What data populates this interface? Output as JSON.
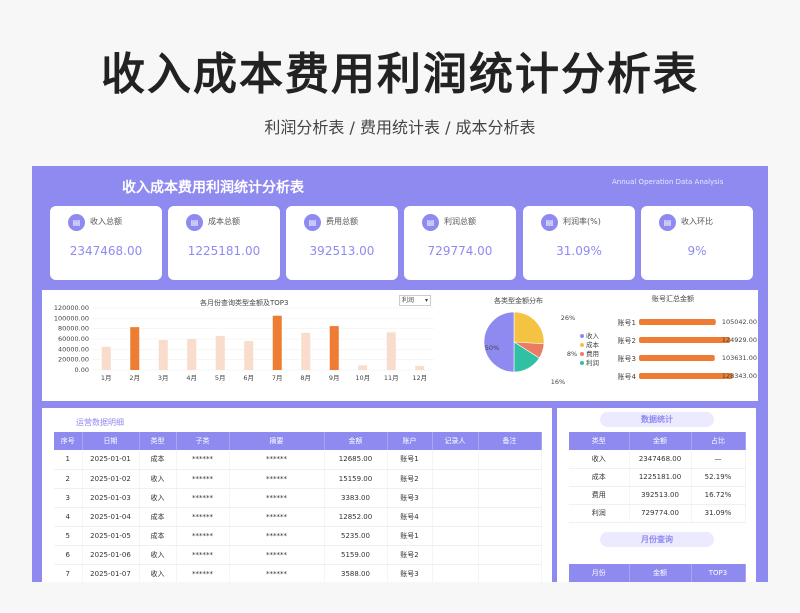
{
  "header": {
    "title": "收入成本费用利润统计分析表",
    "subtitle": "利润分析表 /  费用统计表 / 成本分析表"
  },
  "dashboard": {
    "title": "收入成本费用利润统计分析表",
    "subtitle_en": "Annual Operation Data Analysis"
  },
  "kpis": [
    {
      "label": "收入总额",
      "value": "2347468.00",
      "icon": "wallet-icon"
    },
    {
      "label": "成本总额",
      "value": "1225181.00",
      "icon": "document-icon"
    },
    {
      "label": "费用总额",
      "value": "392513.00",
      "icon": "bar-chart-icon"
    },
    {
      "label": "利润总额",
      "value": "729774.00",
      "icon": "bar-chart-icon"
    },
    {
      "label": "利润率(%)",
      "value": "31.09%",
      "icon": "bar-chart-icon"
    },
    {
      "label": "收入环比",
      "value": "9%",
      "icon": "chat-icon"
    }
  ],
  "monthly_chart": {
    "title": "各月份查询类型金额及TOP3",
    "selector": "利润"
  },
  "pie_chart": {
    "title": "各类型金额分布"
  },
  "account_chart": {
    "title": "账号汇总金额"
  },
  "colors": {
    "accent": "#8f8af0",
    "orange": "#ee7d33",
    "peach": "#f9dccb",
    "yellow": "#f5c342",
    "pink": "#ea7c64",
    "teal": "#32c0a5"
  },
  "chart_data": [
    {
      "type": "bar",
      "title": "各月份查询类型金额及TOP3",
      "categories": [
        "1月",
        "2月",
        "3月",
        "4月",
        "5月",
        "6月",
        "7月",
        "8月",
        "9月",
        "10月",
        "11月",
        "12月"
      ],
      "values": [
        45000,
        83000,
        58000,
        60000,
        66000,
        56000,
        105000,
        72000,
        85000,
        9000,
        73000,
        8000
      ],
      "top3": [
        "2月",
        "7月",
        "9月"
      ],
      "ylim": [
        0,
        120000
      ],
      "yticks": [
        "0.00",
        "20000.00",
        "40000.00",
        "60000.00",
        "80000.00",
        "100000.00",
        "120000.00"
      ]
    },
    {
      "type": "pie",
      "title": "各类型金额分布",
      "labels": [
        "收入",
        "成本",
        "费用",
        "利润"
      ],
      "values": [
        50,
        26,
        8,
        16
      ],
      "value_labels": [
        "50%",
        "26%",
        "8%",
        "16%"
      ]
    },
    {
      "type": "bar",
      "title": "账号汇总金额",
      "categories": [
        "账号1",
        "账号2",
        "账号3",
        "账号4"
      ],
      "values": [
        105042,
        124929,
        103631,
        128343
      ],
      "value_labels": [
        "105042.00",
        "124929.00",
        "103631.00",
        "128343.00"
      ]
    }
  ],
  "detail": {
    "title": "运营数据明细",
    "headers": [
      "序号",
      "日期",
      "类型",
      "子类",
      "摘要",
      "金额",
      "账户",
      "记录人",
      "备注"
    ],
    "rows": [
      [
        "1",
        "2025-01-01",
        "成本",
        "******",
        "******",
        "12685.00",
        "账号1",
        "",
        ""
      ],
      [
        "2",
        "2025-01-02",
        "收入",
        "******",
        "******",
        "15159.00",
        "账号2",
        "",
        ""
      ],
      [
        "3",
        "2025-01-03",
        "收入",
        "******",
        "******",
        "3383.00",
        "账号3",
        "",
        ""
      ],
      [
        "4",
        "2025-01-04",
        "成本",
        "******",
        "******",
        "12852.00",
        "账号4",
        "",
        ""
      ],
      [
        "5",
        "2025-01-05",
        "成本",
        "******",
        "******",
        "5235.00",
        "账号1",
        "",
        ""
      ],
      [
        "6",
        "2025-01-06",
        "收入",
        "******",
        "******",
        "5159.00",
        "账号2",
        "",
        ""
      ],
      [
        "7",
        "2025-01-07",
        "收入",
        "******",
        "******",
        "3588.00",
        "账号3",
        "",
        ""
      ]
    ]
  },
  "stats": {
    "title": "数据统计",
    "headers": [
      "类型",
      "金额",
      "占比"
    ],
    "rows": [
      [
        "收入",
        "2347468.00",
        "—"
      ],
      [
        "成本",
        "1225181.00",
        "52.19%"
      ],
      [
        "费用",
        "392513.00",
        "16.72%"
      ],
      [
        "利润",
        "729774.00",
        "31.09%"
      ]
    ]
  },
  "month_query": {
    "title": "月份查询",
    "headers": [
      "月份",
      "金额",
      "TOP3"
    ]
  }
}
